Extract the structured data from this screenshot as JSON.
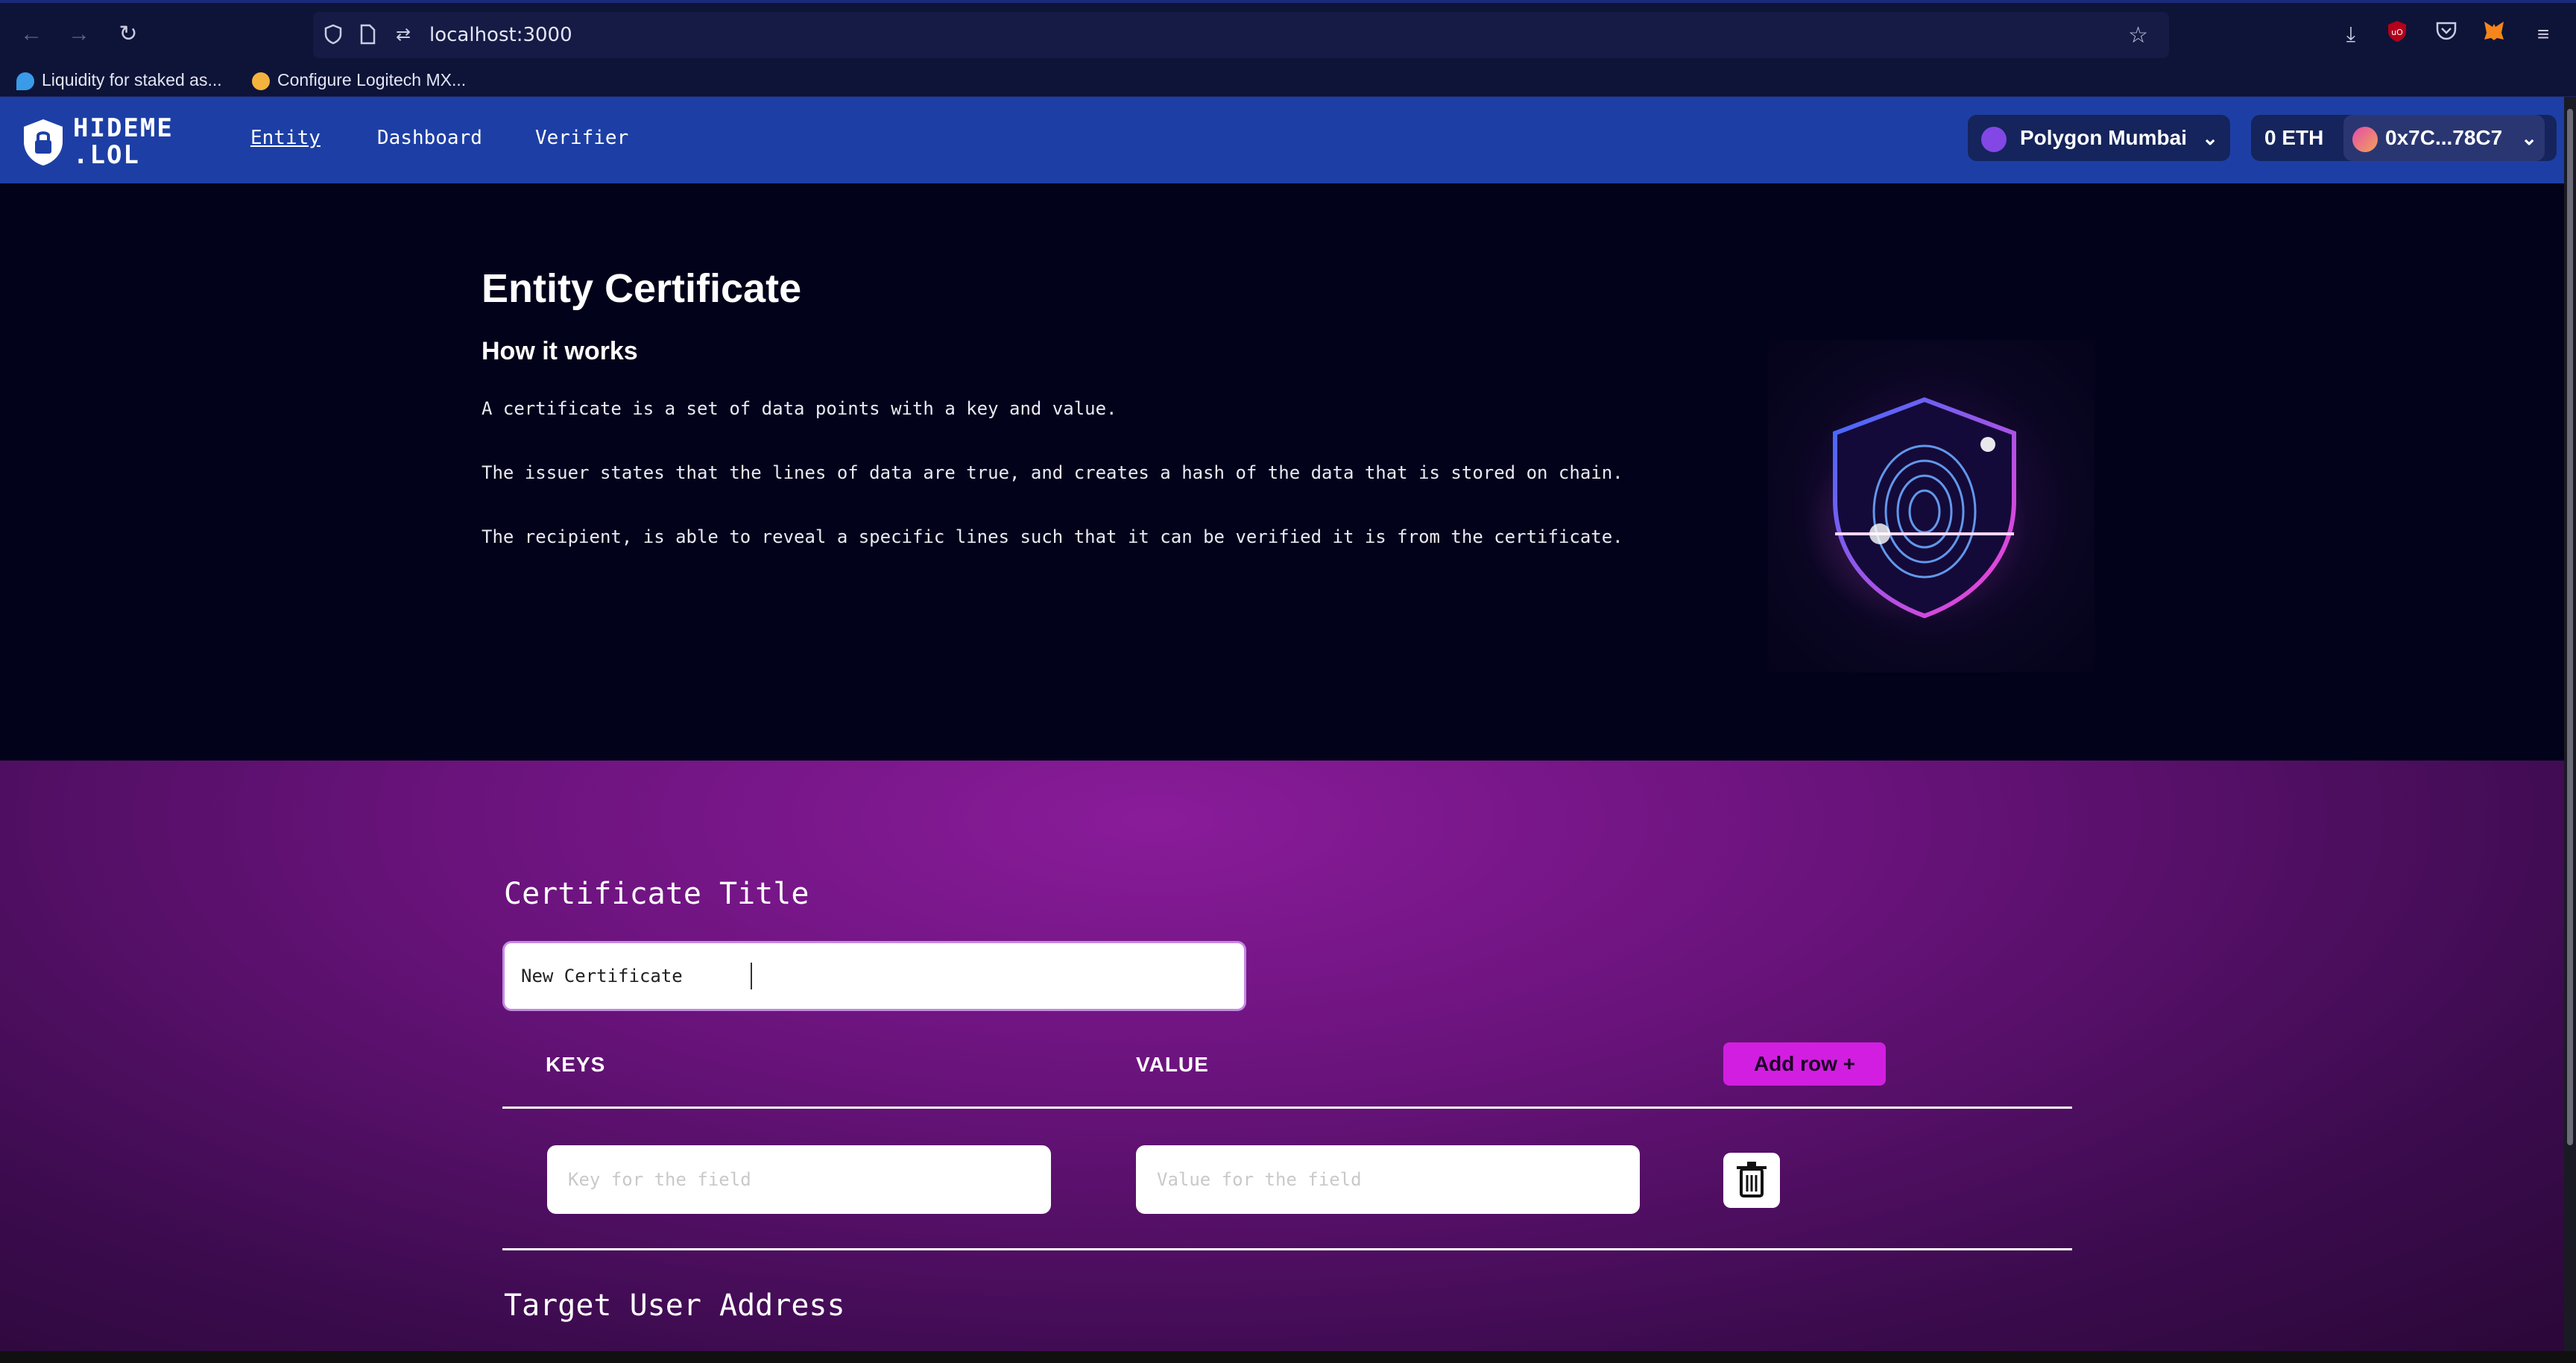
{
  "browser": {
    "url": "localhost:3000",
    "bookmarks": [
      {
        "label": "Liquidity for staked as..."
      },
      {
        "label": "Configure Logitech MX..."
      }
    ]
  },
  "app": {
    "logo_line1": "HIDEME",
    "logo_line2": ".LOL",
    "nav": [
      {
        "label": "Entity",
        "active": true
      },
      {
        "label": "Dashboard",
        "active": false
      },
      {
        "label": "Verifier",
        "active": false
      }
    ],
    "network": "Polygon Mumbai",
    "balance": "0 ETH",
    "account": "0x7C...78C7"
  },
  "hero": {
    "title": "Entity Certificate",
    "subtitle": "How it works",
    "paragraphs": [
      "A certificate is a set of data points with a key and value.",
      "The issuer states that the lines of data are true, and creates a hash of the data that is stored on chain.",
      "The recipient, is able to reveal a specific lines such that it can be verified it is from the certificate."
    ]
  },
  "form": {
    "title_label": "Certificate Title",
    "title_value": "New Certificate",
    "keys_header": "KEYS",
    "value_header": "VALUE",
    "add_row_label": "Add row +",
    "key_placeholder": "Key for the field",
    "value_placeholder": "Value for the field",
    "target_label": "Target User Address"
  },
  "colors": {
    "header_blue": "#1d3fa5",
    "accent_magenta": "#d21ee0",
    "hero_bg": "#02021a"
  }
}
